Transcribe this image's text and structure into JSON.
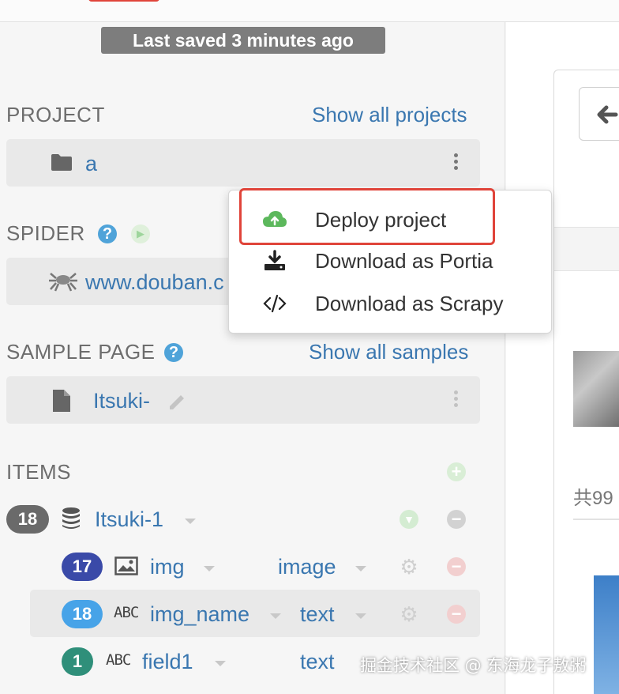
{
  "saved_status": "Last saved 3 minutes ago",
  "project": {
    "heading": "PROJECT",
    "show_all": "Show all projects",
    "name": "a"
  },
  "context_menu": {
    "items": [
      {
        "label": "Deploy project",
        "icon": "cloud-upload-icon"
      },
      {
        "label": "Download as Portia",
        "icon": "download-icon"
      },
      {
        "label": "Download as Scrapy",
        "icon": "code-icon"
      }
    ]
  },
  "spider": {
    "heading": "SPIDER",
    "name": "www.douban.c"
  },
  "sample_page": {
    "heading": "SAMPLE PAGE",
    "show_all": "Show all samples",
    "name": "Itsuki-"
  },
  "items": {
    "heading": "ITEMS",
    "root": {
      "count": "18",
      "name": "Itsuki-1"
    },
    "fields": [
      {
        "count": "17",
        "type_icon": "image-icon",
        "name": "img",
        "type": "image",
        "badge_color": "#3a4aa8"
      },
      {
        "count": "18",
        "type_icon": "ABC",
        "name": "img_name",
        "type": "text",
        "badge_color": "#47a3e8"
      },
      {
        "count": "1",
        "type_icon": "ABC",
        "name": "field1",
        "type": "text",
        "badge_color": "#2f8f7a"
      }
    ]
  },
  "right_panel": {
    "partial_text": "共99"
  },
  "watermark": "掘金技术社区 @ 东海龙子敖粥",
  "colors": {
    "link": "#3a77b0",
    "highlight_border": "#e0443a",
    "success_green": "#5cb85c",
    "help_blue": "#4fa3d9"
  }
}
